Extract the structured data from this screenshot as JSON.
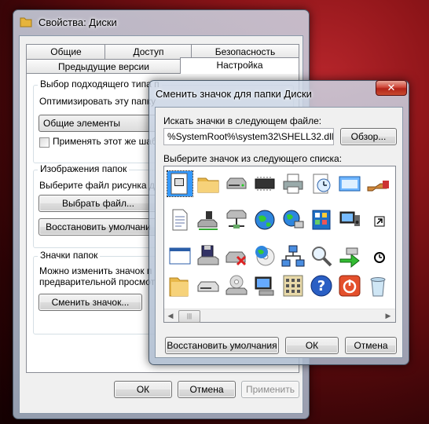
{
  "main_window": {
    "title": "Свойства: Диски",
    "tabs_row1": [
      "Общие",
      "Доступ",
      "Безопасность"
    ],
    "tabs_row2": [
      "Предыдущие версии",
      "Настройка"
    ],
    "active_tab": "Настройка",
    "group1": {
      "label": "Выбор подходящего типа п",
      "optimize_label": "Оптимизировать эту папку",
      "select_value": "Общие элементы",
      "checkbox_label": "Применять этот же шаб"
    },
    "group2": {
      "label": "Изображения папок",
      "desc": "Выберите файл рисунка д",
      "choose_file_btn": "Выбрать файл...",
      "restore_btn": "Восстановить умолчани"
    },
    "group3": {
      "label": "Значки папок",
      "desc_line1": "Можно изменить значок п",
      "desc_line2": "предварительной просмот",
      "change_icon_btn": "Сменить значок..."
    },
    "footer": {
      "ok": "ОК",
      "cancel": "Отмена",
      "apply": "Применить"
    }
  },
  "dialog": {
    "title": "Сменить значок для папки Диски",
    "search_label": "Искать значки в следующем файле:",
    "file_path": "%SystemRoot%\\system32\\SHELL32.dll",
    "browse_btn": "Обзор...",
    "list_label": "Выберите значок из следующего списка:",
    "icons": [
      [
        "file-text-icon",
        "folder-icon",
        "drive-icon",
        "chip-icon",
        "printer-icon",
        "clock-icon",
        "window-icon",
        "hand-icon"
      ],
      [
        "document-icon",
        "network-drive-icon",
        "network-share-icon",
        "globe-icon",
        "network-globe-icon",
        "control-panel-icon",
        "monitor-speaker-icon",
        "shortcut-icon"
      ],
      [
        "blank-window-icon",
        "floppy-icon",
        "drive-remove-icon",
        "globe-cd-icon",
        "network-icon",
        "search-icon",
        "green-arrow-icon",
        "clock-small-icon"
      ],
      [
        "folder-open-icon",
        "hdd-icon",
        "cd-drive-icon",
        "computer-icon",
        "calculator-icon",
        "help-icon",
        "power-icon",
        "recycle-bin-icon"
      ]
    ],
    "footer": {
      "restore": "Восстановить умолчания",
      "ok": "ОК",
      "cancel": "Отмена"
    }
  },
  "colors": {
    "accent": "#3399ff",
    "close": "#c8382a"
  }
}
